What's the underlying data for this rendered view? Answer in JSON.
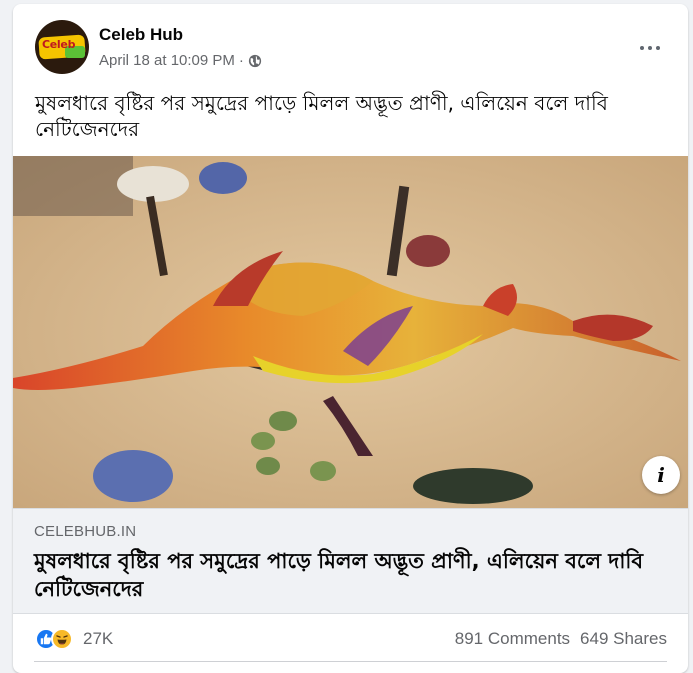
{
  "post": {
    "page_name": "Celeb Hub",
    "avatar_logo_text": "Celeb Hub",
    "timestamp": "April 18 at 10:09 PM",
    "separator": "·",
    "audience_icon": "globe-icon",
    "more_icon": "more-options-icon",
    "text": "মুষলধারে বৃষ্টির পর সমুদ্রের পাড়ে মিলল অদ্ভূত প্রাণী, এলিয়েন বলে দাবি নেটিজেনদের"
  },
  "link_preview": {
    "domain": "CELEBHUB.IN",
    "title": "মুষলধারে বৃষ্টির পর সমুদ্রের পাড়ে মিলল অদ্ভূত প্রাণী, এলিয়েন বলে দাবি নেটিজেনদের",
    "info_label": "i"
  },
  "stats": {
    "reaction_icons": [
      "like-icon",
      "haha-icon"
    ],
    "reaction_count": "27K",
    "comments": "891 Comments",
    "shares": "649 Shares"
  },
  "colors": {
    "background": "#f0f2f5",
    "card": "#ffffff",
    "like_blue": "#1877f2",
    "haha_yellow": "#f7b928",
    "secondary_text": "#65676b"
  }
}
